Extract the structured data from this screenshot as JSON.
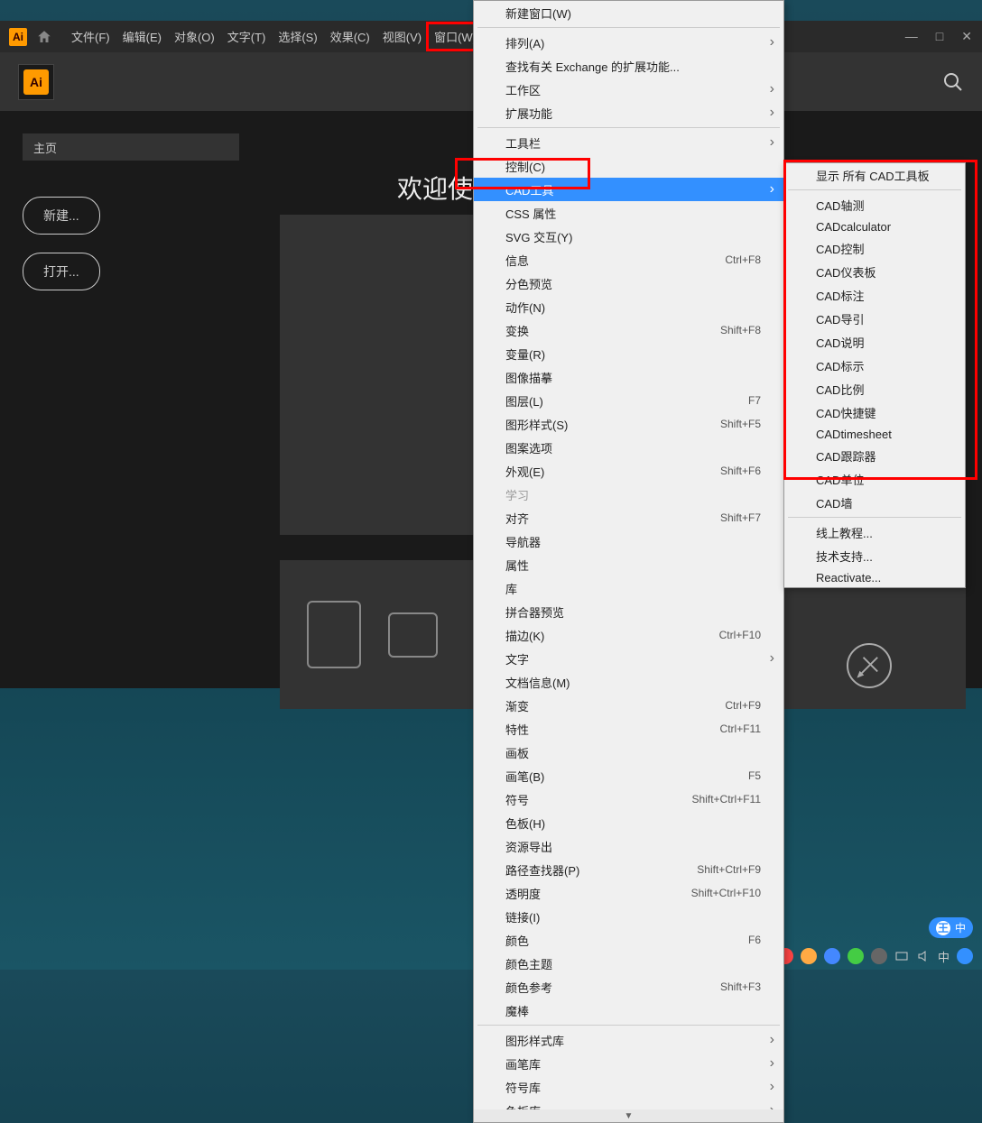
{
  "logo": "Ai",
  "menubar": [
    "文件(F)",
    "编辑(E)",
    "对象(O)",
    "文字(T)",
    "选择(S)",
    "效果(C)",
    "视图(V)",
    "窗口(W)"
  ],
  "highlighted_menu": "窗口(W)",
  "window_controls": [
    "—",
    "□",
    "✕"
  ],
  "page_title": "主页",
  "btn_new": "新建...",
  "btn_open": "打开...",
  "welcome": "欢迎使",
  "dropdown": [
    {
      "label": "新建窗口(W)"
    },
    {
      "divider": true
    },
    {
      "label": "排列(A)",
      "submenu": true
    },
    {
      "label": "查找有关 Exchange 的扩展功能..."
    },
    {
      "label": "工作区",
      "submenu": true
    },
    {
      "label": "扩展功能",
      "submenu": true
    },
    {
      "divider": true
    },
    {
      "label": "工具栏",
      "submenu": true
    },
    {
      "label": "控制(C)"
    },
    {
      "label": "CAD工具",
      "submenu": true,
      "selected": true
    },
    {
      "label": "CSS 属性"
    },
    {
      "label": "SVG 交互(Y)"
    },
    {
      "label": "信息",
      "shortcut": "Ctrl+F8"
    },
    {
      "label": "分色预览"
    },
    {
      "label": "动作(N)"
    },
    {
      "label": "变换",
      "shortcut": "Shift+F8"
    },
    {
      "label": "变量(R)"
    },
    {
      "label": "图像描摹"
    },
    {
      "label": "图层(L)",
      "shortcut": "F7"
    },
    {
      "label": "图形样式(S)",
      "shortcut": "Shift+F5"
    },
    {
      "label": "图案选项"
    },
    {
      "label": "外观(E)",
      "shortcut": "Shift+F6"
    },
    {
      "label": "学习",
      "disabled": true
    },
    {
      "label": "对齐",
      "shortcut": "Shift+F7"
    },
    {
      "label": "导航器"
    },
    {
      "label": "属性"
    },
    {
      "label": "库"
    },
    {
      "label": "拼合器预览"
    },
    {
      "label": "描边(K)",
      "shortcut": "Ctrl+F10"
    },
    {
      "label": "文字",
      "submenu": true
    },
    {
      "label": "文档信息(M)"
    },
    {
      "label": "渐变",
      "shortcut": "Ctrl+F9"
    },
    {
      "label": "特性",
      "shortcut": "Ctrl+F11"
    },
    {
      "label": "画板"
    },
    {
      "label": "画笔(B)",
      "shortcut": "F5"
    },
    {
      "label": "符号",
      "shortcut": "Shift+Ctrl+F11"
    },
    {
      "label": "色板(H)"
    },
    {
      "label": "资源导出"
    },
    {
      "label": "路径查找器(P)",
      "shortcut": "Shift+Ctrl+F9"
    },
    {
      "label": "透明度",
      "shortcut": "Shift+Ctrl+F10"
    },
    {
      "label": "链接(I)"
    },
    {
      "label": "颜色",
      "shortcut": "F6"
    },
    {
      "label": "颜色主题"
    },
    {
      "label": "颜色参考",
      "shortcut": "Shift+F3"
    },
    {
      "label": "魔棒"
    },
    {
      "divider": true
    },
    {
      "label": "图形样式库",
      "submenu": true
    },
    {
      "label": "画笔库",
      "submenu": true
    },
    {
      "label": "符号库",
      "submenu": true
    },
    {
      "label": "色板库",
      "submenu": true
    }
  ],
  "submenu": [
    "显示 所有 CAD工具板",
    "",
    "CAD轴测",
    "CADcalculator",
    "CAD控制",
    "CAD仪表板",
    "CAD标注",
    "CAD导引",
    "CAD说明",
    "CAD标示",
    "CAD比例",
    "CAD快捷键",
    "CADtimesheet",
    "CAD跟踪器",
    "CAD单位",
    "CAD墙",
    "",
    "线上教程...",
    "技术支持...",
    "Reactivate..."
  ],
  "ime": "中",
  "ime_badge": "王"
}
